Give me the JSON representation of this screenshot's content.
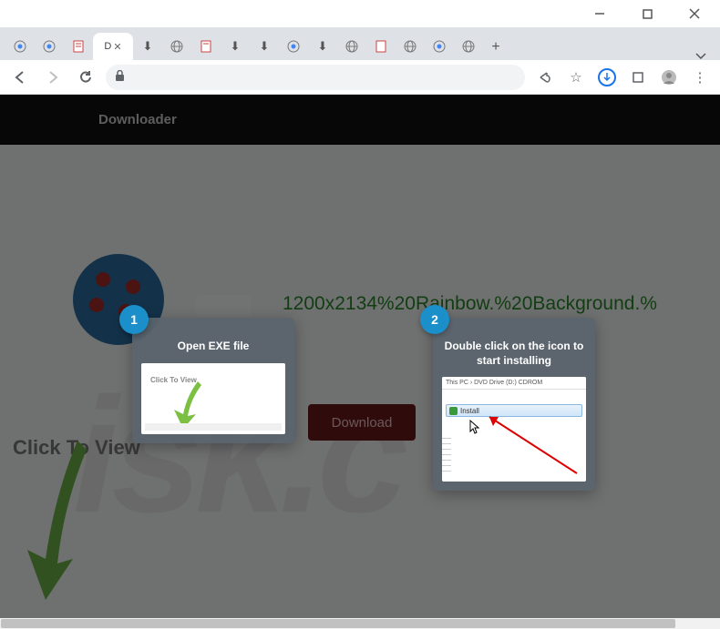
{
  "window": {
    "tabs": [
      {
        "icon": "chrome",
        "active": false
      },
      {
        "icon": "chrome",
        "active": false
      },
      {
        "icon": "page",
        "active": false
      },
      {
        "icon": "doc",
        "active": true,
        "label": "D",
        "closeable": true
      },
      {
        "icon": "download",
        "active": false
      },
      {
        "icon": "globe",
        "active": false
      },
      {
        "icon": "page",
        "active": false
      },
      {
        "icon": "download",
        "active": false
      },
      {
        "icon": "download",
        "active": false
      },
      {
        "icon": "chrome",
        "active": false
      },
      {
        "icon": "download",
        "active": false
      },
      {
        "icon": "globe",
        "active": false
      },
      {
        "icon": "page",
        "active": false
      },
      {
        "icon": "globe",
        "active": false
      },
      {
        "icon": "chrome",
        "active": false
      },
      {
        "icon": "globe",
        "active": false
      }
    ]
  },
  "page": {
    "header_title": "Downloader",
    "filename": "1200x2134%20Rainbow.%20Background.%",
    "download_label": "Download",
    "click_to_view": "Click To View"
  },
  "popup": {
    "step1": {
      "number": "1",
      "title": "Open EXE file",
      "preview_text": "Click To View"
    },
    "step2": {
      "number": "2",
      "title": "Double click on the icon to start installing",
      "breadcrumb": "This PC   ›   DVD Drive (D:) CDROM",
      "install_label": "Install"
    }
  }
}
